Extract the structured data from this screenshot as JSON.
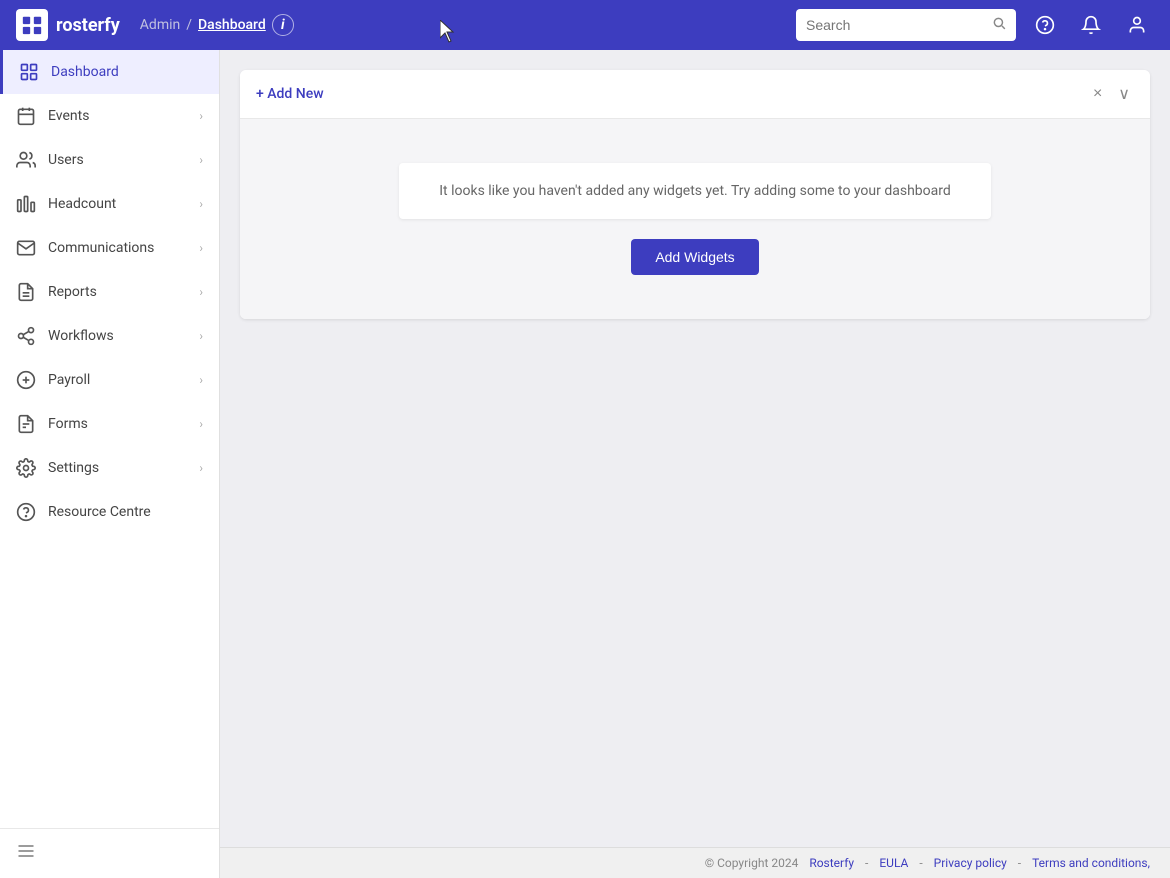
{
  "app": {
    "name": "rosterfy",
    "logo_alt": "Rosterfy logo"
  },
  "topnav": {
    "breadcrumb_admin": "Admin",
    "breadcrumb_sep": "/",
    "breadcrumb_current": "Dashboard",
    "info_label": "i",
    "search_placeholder": "Search",
    "colors": {
      "background": "#3d3dbf",
      "active_nav": "#eeeeff"
    }
  },
  "sidebar": {
    "items": [
      {
        "id": "dashboard",
        "label": "Dashboard",
        "active": true
      },
      {
        "id": "events",
        "label": "Events",
        "active": false
      },
      {
        "id": "users",
        "label": "Users",
        "active": false
      },
      {
        "id": "headcount",
        "label": "Headcount",
        "active": false
      },
      {
        "id": "communications",
        "label": "Communications",
        "active": false
      },
      {
        "id": "reports",
        "label": "Reports",
        "active": false
      },
      {
        "id": "workflows",
        "label": "Workflows",
        "active": false
      },
      {
        "id": "payroll",
        "label": "Payroll",
        "active": false
      },
      {
        "id": "forms",
        "label": "Forms",
        "active": false
      },
      {
        "id": "settings",
        "label": "Settings",
        "active": false
      },
      {
        "id": "resource-centre",
        "label": "Resource Centre",
        "active": false
      }
    ],
    "bottom_toggle_label": "☰"
  },
  "main": {
    "panel": {
      "add_new_label": "+ Add New",
      "empty_message": "It looks like you haven't added any widgets yet. Try adding some to your dashboard",
      "add_widgets_label": "Add Widgets"
    }
  },
  "footer": {
    "copyright": "© Copyright 2024",
    "brand": "Rosterfy",
    "sep1": "-",
    "eula": "EULA",
    "sep2": "-",
    "privacy": "Privacy policy",
    "sep3": "-",
    "terms": "Terms and conditions,"
  }
}
